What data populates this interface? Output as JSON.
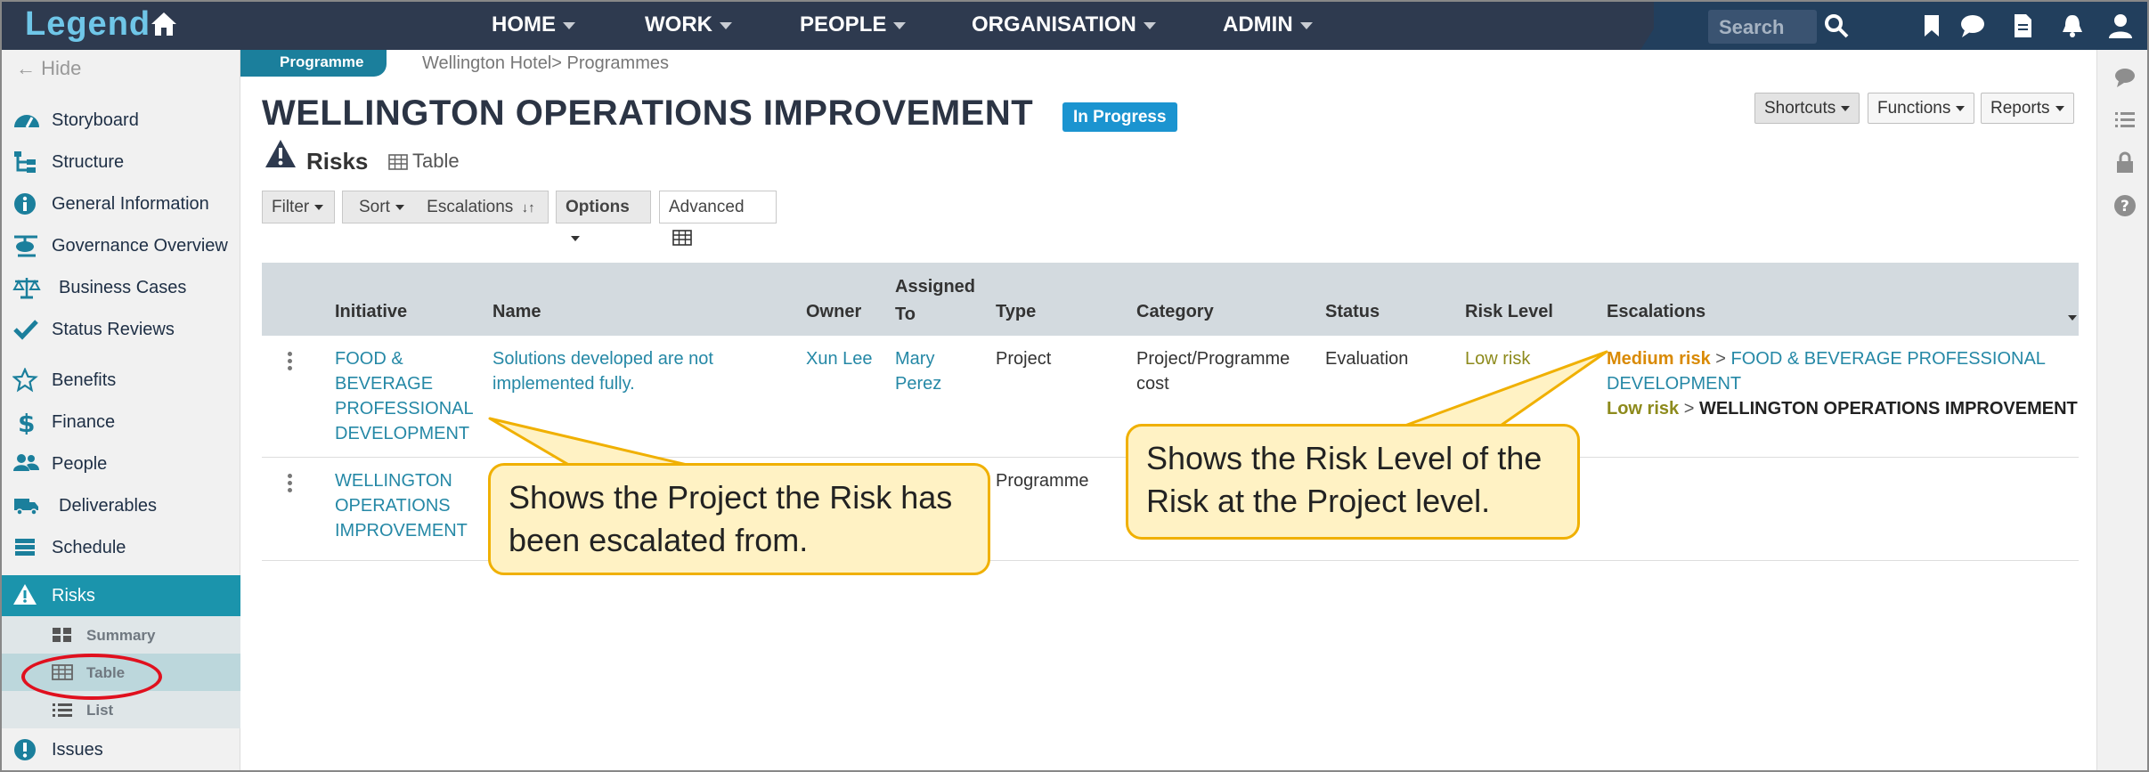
{
  "app": {
    "logo": "Legend"
  },
  "nav": {
    "items": [
      {
        "label": "HOME"
      },
      {
        "label": "WORK"
      },
      {
        "label": "PEOPLE"
      },
      {
        "label": "ORGANISATION"
      },
      {
        "label": "ADMIN"
      }
    ],
    "search_placeholder": "Search"
  },
  "sidebar": {
    "hide_label": "Hide",
    "items": [
      {
        "label": "Storyboard"
      },
      {
        "label": "Structure"
      },
      {
        "label": "General Information"
      },
      {
        "label": "Governance Overview"
      },
      {
        "label": "Business Cases"
      },
      {
        "label": "Status Reviews"
      },
      {
        "label": "Benefits"
      },
      {
        "label": "Finance"
      },
      {
        "label": "People"
      },
      {
        "label": "Deliverables"
      },
      {
        "label": "Schedule"
      },
      {
        "label": "Risks"
      },
      {
        "label": "Issues"
      }
    ],
    "sub_items": [
      {
        "label": "Summary"
      },
      {
        "label": "Table"
      },
      {
        "label": "List"
      }
    ]
  },
  "header": {
    "badge": "Programme",
    "breadcrumb": "Wellington Hotel> Programmes",
    "title": "WELLINGTON OPERATIONS IMPROVEMENT",
    "status": "In Progress",
    "buttons": {
      "shortcuts": "Shortcuts",
      "functions": "Functions",
      "reports": "Reports"
    },
    "section_title": "Risks",
    "view_label": "Table"
  },
  "toolbar": {
    "filter": "Filter",
    "sort": "Sort",
    "sort_field": "Escalations",
    "options": "Options",
    "advanced": "Advanced"
  },
  "table": {
    "headers": {
      "initiative": "Initiative",
      "name": "Name",
      "owner": "Owner",
      "assigned_l1": "Assigned",
      "assigned_l2": "To",
      "type": "Type",
      "category": "Category",
      "status": "Status",
      "risk_level": "Risk Level",
      "escalations": "Escalations"
    },
    "rows": [
      {
        "initiative_lines": [
          "FOOD &",
          "BEVERAGE",
          "PROFESSIONAL",
          "DEVELOPMENT"
        ],
        "name_lines": [
          "Solutions developed are not",
          "implemented fully."
        ],
        "owner": "Xun Lee",
        "assigned_lines": [
          "Mary",
          "Perez"
        ],
        "type": "Project",
        "category_lines": [
          "Project/Programme",
          "cost"
        ],
        "status": "Evaluation",
        "risk_level": "Low risk",
        "esc1_level": "Medium risk",
        "esc1_sep": " > ",
        "esc1_target_l1": "FOOD & BEVERAGE PROFESSIONAL",
        "esc1_target_l2": "DEVELOPMENT",
        "esc2_level": "Low risk",
        "esc2_sep": " > ",
        "esc2_target": "WELLINGTON OPERATIONS IMPROVEMENT"
      },
      {
        "initiative_lines": [
          "WELLINGTON",
          "OPERATIONS",
          "IMPROVEMENT"
        ],
        "type": "Programme"
      }
    ]
  },
  "callouts": {
    "left_lines": [
      "Shows the Project the Risk has",
      "been escalated from."
    ],
    "right_lines": [
      "Shows the Risk Level of the",
      "Risk at the Project level."
    ]
  },
  "colors": {
    "topbar": "#2e3a4f",
    "accent": "#1b94ac",
    "link": "#2588a6",
    "status_pill": "#1b94d0",
    "medium_risk": "#d98a05",
    "low_risk": "#8d8a1c",
    "callout_fill": "#fff2c4",
    "callout_border": "#f0b000",
    "highlight_ellipse": "#e0101e"
  }
}
